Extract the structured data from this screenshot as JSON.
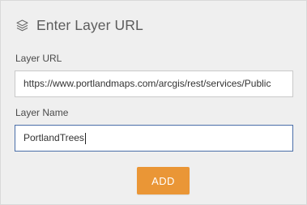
{
  "dialog": {
    "title": "Enter Layer URL",
    "icon": "layers-icon"
  },
  "url_field": {
    "label": "Layer URL",
    "value": "https://www.portlandmaps.com/arcgis/rest/services/Public"
  },
  "name_field": {
    "label": "Layer Name",
    "value": "PortlandTrees"
  },
  "actions": {
    "add_label": "ADD",
    "add_color": "#ea9636"
  }
}
